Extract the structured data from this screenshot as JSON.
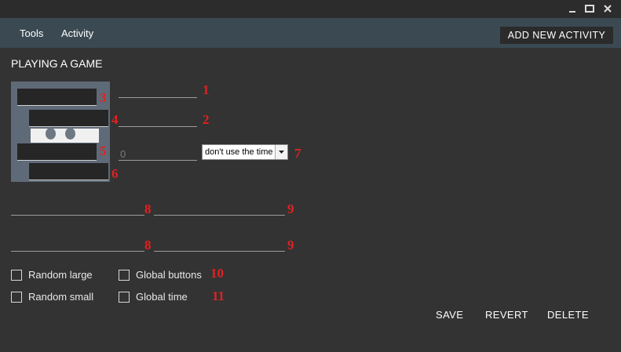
{
  "menubar": {
    "tools_label": "Tools",
    "activity_label": "Activity",
    "add_activity_label": "ADD NEW ACTIVITY"
  },
  "page": {
    "title": "PLAYING A GAME"
  },
  "form": {
    "details_value": "",
    "state_value": "",
    "party_value": "",
    "party_placeholder": "0",
    "time_select_value": "don't use the time",
    "button1_label_value": "",
    "button1_url_value": "",
    "button2_label_value": "",
    "button2_url_value": ""
  },
  "checkboxes": {
    "random_large": "Random large",
    "random_small": "Random small",
    "global_buttons": "Global buttons",
    "global_time": "Global time"
  },
  "annotations": {
    "n1": "1",
    "n2": "2",
    "n3": "3",
    "n4": "4",
    "n5": "5",
    "n6": "6",
    "n7": "7",
    "n8a": "8",
    "n8b": "8",
    "n9a": "9",
    "n9b": "9",
    "n10": "10",
    "n11": "11"
  },
  "actions": {
    "save": "SAVE",
    "revert": "REVERT",
    "delete": "DELETE"
  },
  "colors": {
    "background": "#333333",
    "menubar": "#3b4a52",
    "preview": "#5f6a78",
    "annotation_red": "#e32020"
  },
  "icons": [
    "minimize-icon",
    "maximize-icon",
    "close-icon",
    "dropdown-arrow-icon"
  ]
}
